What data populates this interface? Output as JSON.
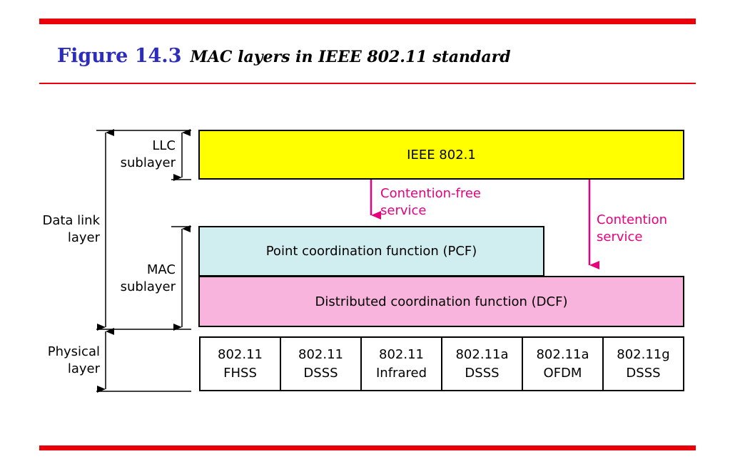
{
  "colors": {
    "rule_red": "#e8000b",
    "title_blue": "#2c2cbf",
    "llc_box_fill": "#ffff00",
    "pcf_box_fill": "#d0eef0",
    "dcf_box_fill": "#f8b4dc",
    "arrow_magenta": "#e6007e"
  },
  "figure": {
    "number": "Figure 14.3",
    "caption": "MAC layers in IEEE 802.11 standard"
  },
  "labels": {
    "llc_sublayer": "LLC\nsublayer",
    "data_link_layer": "Data link\nlayer",
    "mac_sublayer": "MAC\nsublayer",
    "physical_layer": "Physical\nlayer"
  },
  "boxes": {
    "llc": "IEEE 802.1",
    "pcf": "Point coordination function (PCF)",
    "dcf": "Distributed coordination function (DCF)"
  },
  "services": {
    "contention_free": "Contention-free\nservice",
    "contention": "Contention\nservice"
  },
  "physical": [
    {
      "line1": "802.11",
      "line2": "FHSS"
    },
    {
      "line1": "802.11",
      "line2": "DSSS"
    },
    {
      "line1": "802.11",
      "line2": "Infrared"
    },
    {
      "line1": "802.11a",
      "line2": "DSSS"
    },
    {
      "line1": "802.11a",
      "line2": "OFDM"
    },
    {
      "line1": "802.11g",
      "line2": "DSSS"
    }
  ]
}
